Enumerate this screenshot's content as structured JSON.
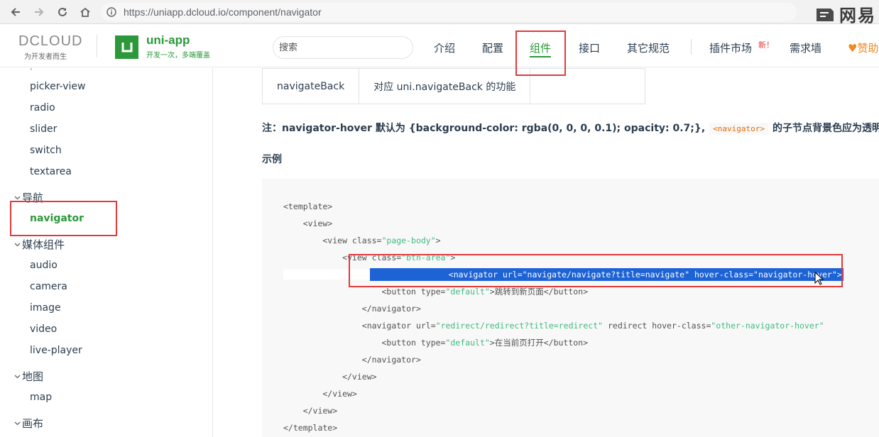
{
  "browser": {
    "url": "https://uniapp.dcloud.io/component/navigator",
    "watermark": "网易"
  },
  "header": {
    "dcloud_logo": "DCLOUD",
    "dcloud_slogan": "为开发者而生",
    "brand_name": "uni-app",
    "brand_tagline": "开发一次，多端覆盖",
    "search_placeholder": "搜索",
    "nav": [
      {
        "label": "介绍"
      },
      {
        "label": "配置"
      },
      {
        "label": "组件",
        "active": true
      },
      {
        "label": "接口"
      },
      {
        "label": "其它规范"
      },
      {
        "label": "插件市场"
      },
      {
        "label": "需求墙"
      }
    ],
    "new_badge": "新！",
    "donate": "赞助"
  },
  "sidebar": {
    "top_partial": "picker",
    "items_form": [
      "picker-view",
      "radio",
      "slider",
      "switch",
      "textarea"
    ],
    "group_nav": "导航",
    "item_navigator": "navigator",
    "group_media": "媒体组件",
    "items_media": [
      "audio",
      "camera",
      "image",
      "video",
      "live-player"
    ],
    "group_map": "地图",
    "item_map": "map",
    "group_canvas": "画布"
  },
  "content": {
    "table_row": [
      "navigateBack",
      "对应 uni.navigateBack 的功能",
      ""
    ],
    "note_prefix": "注：navigator-hover 默认为 {background-color: rgba(0, 0, 0, 0.1); opacity: 0.7;},",
    "note_code": "<navigator>",
    "note_suffix": "的子节点背景色应为透明色。",
    "example_title": "示例",
    "code_lines": [
      {
        "t": "<template>"
      },
      {
        "t": "    <view>"
      },
      {
        "t": "        <view class=",
        "s": "\"page-body\"",
        "e": ">"
      },
      {
        "t": "            <view class=",
        "s": "\"btn-area\"",
        "e": ">"
      },
      {
        "t": "                <navigator url=\"navigate/navigate?title=navigate\" hover-class=\"navigator-hover\">"
      },
      {
        "t": "                    <button type=",
        "s": "\"default\"",
        "e": ">跳转到新页面</button>"
      },
      {
        "t": "                </navigator>"
      },
      {
        "t": "                <navigator url=",
        "s": "\"redirect/redirect?title=redirect\"",
        "e": " redirect hover-class=",
        "s2": "\"other-navigator-hover\""
      },
      {
        "t": "                    <button type=",
        "s": "\"default\"",
        "e": ">在当前页打开</button>"
      },
      {
        "t": "                </navigator>"
      },
      {
        "t": "            </view>"
      },
      {
        "t": "        </view>"
      },
      {
        "t": "    </view>"
      },
      {
        "t": "</template>"
      }
    ]
  },
  "colors": {
    "brand_green": "#2b9939",
    "highlight_red": "#e23a3a",
    "selection_blue": "#1e63d6",
    "donate_orange": "#f08a24"
  }
}
